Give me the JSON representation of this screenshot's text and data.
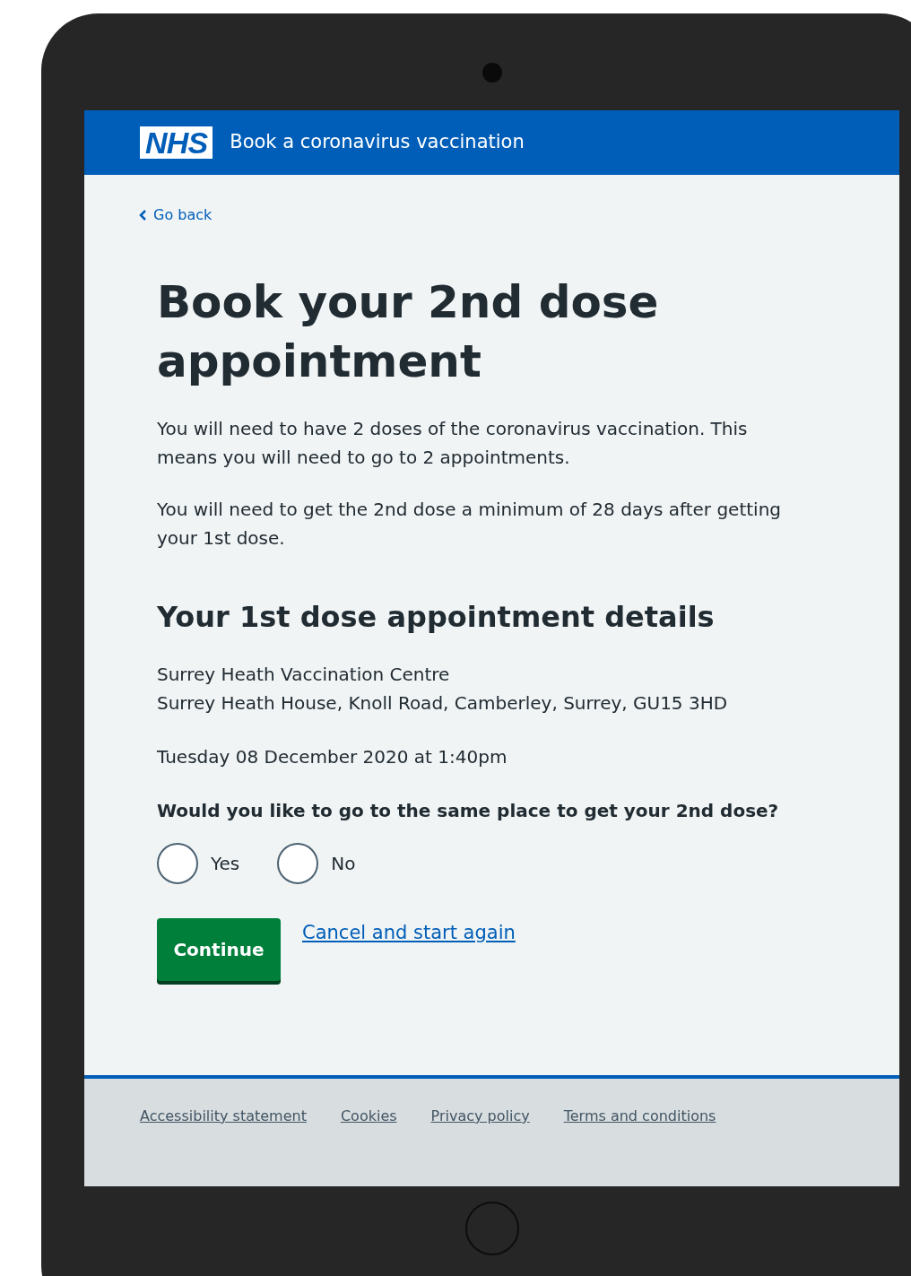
{
  "header": {
    "logo": "NHS",
    "title": "Book a coronavirus vaccination"
  },
  "back_link": "Go back",
  "heading": "Book your 2nd dose appointment",
  "paragraphs": [
    "You will need to have 2 doses of the coronavirus vaccination. This means you will need to go to 2 appointments.",
    "You will need to get the 2nd dose a minimum of 28 days after getting your 1st dose."
  ],
  "appointment": {
    "heading": "Your 1st dose appointment details",
    "place": "Surrey Heath Vaccination Centre",
    "address": "Surrey Heath House, Knoll Road, Camberley, Surrey, GU15 3HD",
    "datetime": "Tuesday 08 December 2020 at 1:40pm"
  },
  "question": {
    "label": "Would you like to go to the same place to get your 2nd dose?",
    "options": [
      {
        "label": "Yes",
        "selected": false
      },
      {
        "label": "No",
        "selected": false
      }
    ]
  },
  "continue_button": "Continue",
  "cancel_link": "Cancel and start again",
  "footer": {
    "links": [
      "Accessibility statement",
      "Cookies",
      "Privacy policy",
      "Terms and conditions"
    ]
  }
}
